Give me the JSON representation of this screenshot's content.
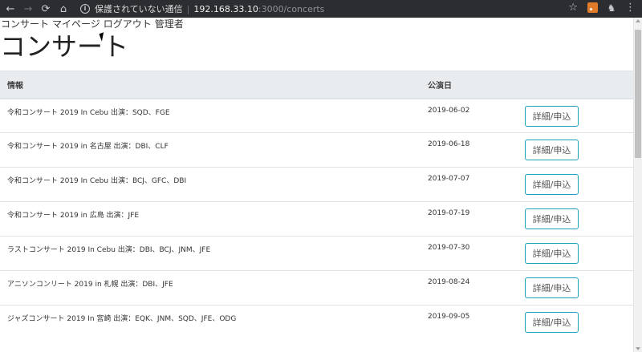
{
  "browser": {
    "back_icon": "←",
    "forward_icon": "→",
    "reload_icon": "⟳",
    "home_icon": "⌂",
    "info_icon": "i",
    "not_secure": "保護されていない通信",
    "separator": "|",
    "host": "192.168.33.10",
    "path": ":3000/concerts",
    "star_icon": "☆",
    "ext_icon": "♞",
    "menu_icon": "⋮"
  },
  "nav": {
    "concert": "コンサート",
    "mypage": "マイページ",
    "logout": "ログアウト",
    "admin": "管理者"
  },
  "page_title": "コンサート",
  "table": {
    "headers": {
      "info": "情報",
      "date": "公演日",
      "action": ""
    },
    "rows": [
      {
        "info": "令和コンサート 2019 In Cebu 出演：SQD、FGE",
        "date": "2019-06-02",
        "button": "詳細/申込"
      },
      {
        "info": "令和コンサート 2019 in 名古屋 出演：DBI、CLF",
        "date": "2019-06-18",
        "button": "詳細/申込"
      },
      {
        "info": "令和コンサート 2019 In Cebu 出演：BCJ、GFC、DBI",
        "date": "2019-07-07",
        "button": "詳細/申込"
      },
      {
        "info": "令和コンサート 2019 in 広島 出演：JFE",
        "date": "2019-07-19",
        "button": "詳細/申込"
      },
      {
        "info": "ラストコンサート 2019 In Cebu 出演：DBI、BCJ、JNM、JFE",
        "date": "2019-07-30",
        "button": "詳細/申込"
      },
      {
        "info": "アニソンコンリート 2019 in 札幌 出演：DBI、JFE",
        "date": "2019-08-24",
        "button": "詳細/申込"
      },
      {
        "info": "ジャズコンサート 2019 In 宮崎 出演：EQK、JNM、SQD、JFE、ODG",
        "date": "2019-09-05",
        "button": "詳細/申込"
      }
    ]
  }
}
